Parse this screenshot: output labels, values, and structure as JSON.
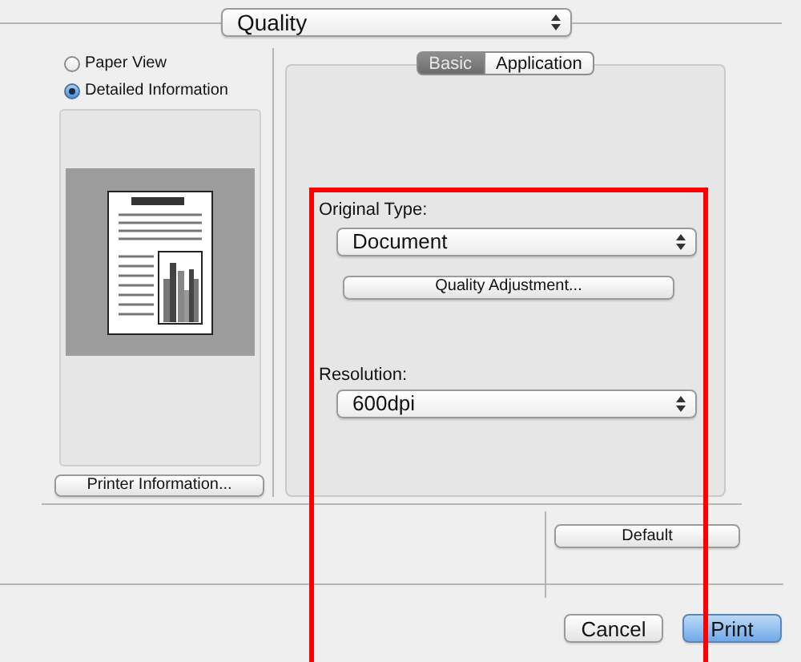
{
  "panel_menu": {
    "value": "Quality"
  },
  "preview_options": [
    {
      "label": "Paper View",
      "selected": false
    },
    {
      "label": "Detailed Information",
      "selected": true
    }
  ],
  "printer_information_button": "Printer Information...",
  "tabs": [
    {
      "label": "Basic",
      "selected": true
    },
    {
      "label": "Application",
      "selected": false
    }
  ],
  "original_type": {
    "label": "Original Type:",
    "value": "Document"
  },
  "quality_adjustment_button": "Quality Adjustment...",
  "resolution": {
    "label": "Resolution:",
    "value": "600dpi"
  },
  "default_button": "Default",
  "buttons": [
    {
      "label": "Cancel",
      "kind": "normal"
    },
    {
      "label": "Print",
      "kind": "default"
    }
  ]
}
